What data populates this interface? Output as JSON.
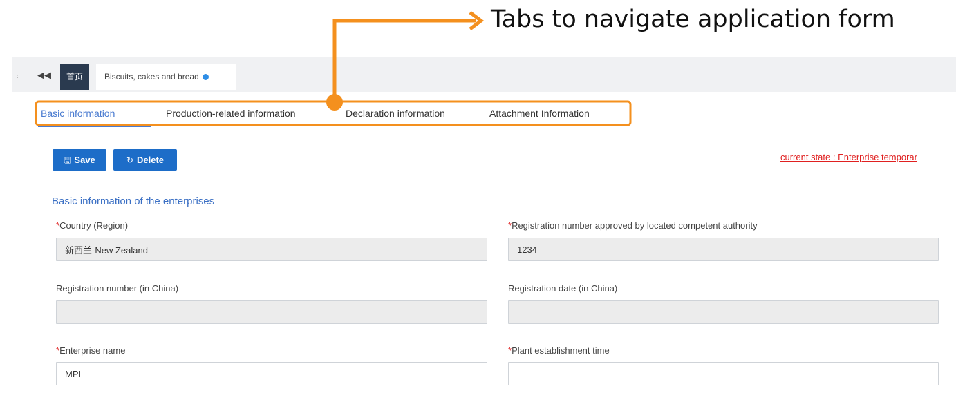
{
  "annotation": {
    "text": "Tabs to navigate application form",
    "color": "#f4901e"
  },
  "tabstrip": {
    "home_label": "首页",
    "doc_tab_label": "Biscuits, cakes and bread"
  },
  "subtabs": [
    {
      "label": "Basic information",
      "active": true
    },
    {
      "label": "Production-related information",
      "active": false
    },
    {
      "label": "Declaration information",
      "active": false
    },
    {
      "label": "Attachment Information",
      "active": false
    }
  ],
  "toolbar": {
    "save_label": "Save",
    "delete_label": "Delete"
  },
  "status": {
    "text": "current state : Enterprise temporar"
  },
  "section": {
    "title": "Basic information of the enterprises"
  },
  "fields": {
    "country": {
      "label": "Country (Region)",
      "required": true,
      "value": "新西兰-New Zealand"
    },
    "reg_number_local": {
      "label": "Registration number approved by located competent authority",
      "required": true,
      "value": "1234"
    },
    "reg_number_china": {
      "label": "Registration number (in China)",
      "required": false,
      "value": ""
    },
    "reg_date_china": {
      "label": "Registration date (in China)",
      "required": false,
      "value": ""
    },
    "enterprise_name": {
      "label": "Enterprise name",
      "required": true,
      "value": "MPI"
    },
    "plant_time": {
      "label": "Plant establishment time",
      "required": true,
      "value": ""
    }
  },
  "colors": {
    "accent": "#4a7bd0",
    "button": "#1d6dc8",
    "required": "#e02020",
    "home_tab": "#2a3a4f"
  }
}
